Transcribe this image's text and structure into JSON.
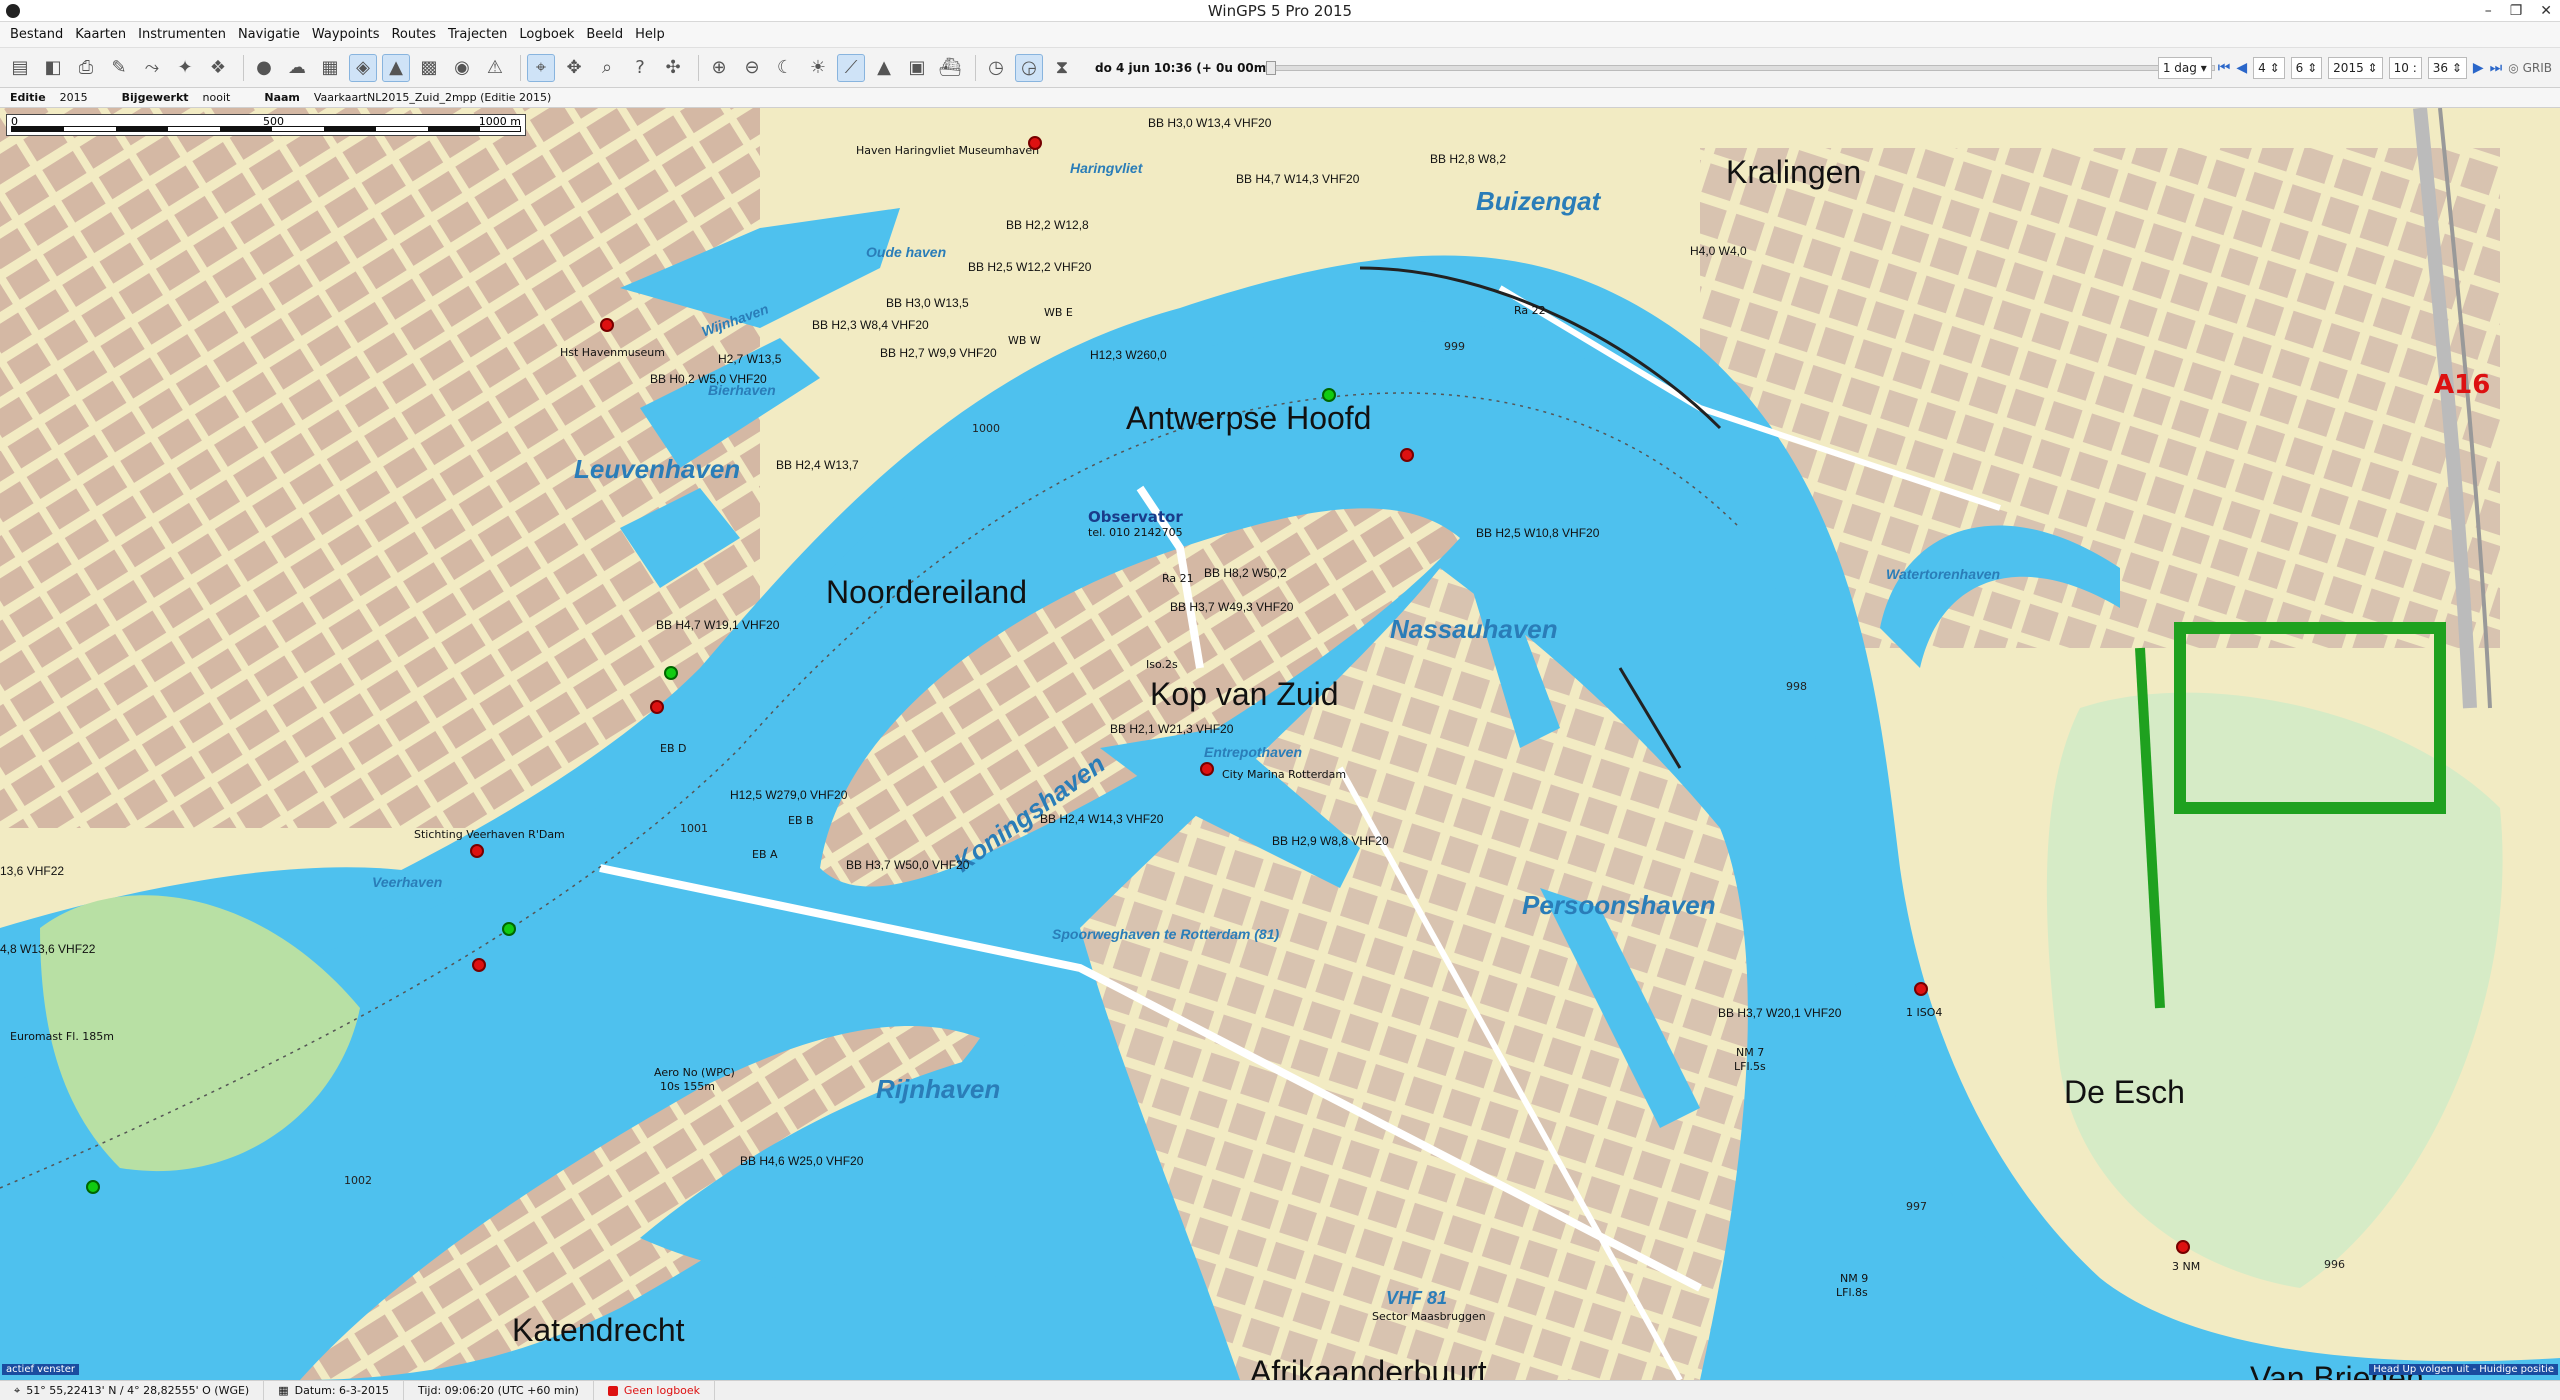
{
  "window": {
    "title": "WinGPS 5 Pro 2015"
  },
  "menu": [
    "Bestand",
    "Kaarten",
    "Instrumenten",
    "Navigatie",
    "Waypoints",
    "Routes",
    "Trajecten",
    "Logboek",
    "Beeld",
    "Help"
  ],
  "toolbar": {
    "datetime": "do 4 jun 10:36 (+ 0u 00m)",
    "interval": "1 dag",
    "day": "4",
    "month": "6",
    "year": "2015",
    "hour": "10",
    "minute": "36",
    "grib_label": "GRIB"
  },
  "infobar": {
    "edition_label": "Editie",
    "edition_value": "2015",
    "updated_label": "Bijgewerkt",
    "updated_value": "nooit",
    "name_label": "Naam",
    "name_value": "VaarkaartNL2015_Zuid_2mpp (Editie 2015)"
  },
  "map": {
    "scale": {
      "start": "0",
      "mid": "500",
      "end": "1000 m"
    },
    "places": [
      "Kralingen",
      "Antwerpse Hoofd",
      "Noordereiland",
      "Kop van Zuid",
      "De Esch",
      "Katendrecht",
      "Afrikaanderbuurt",
      "Van Brienen"
    ],
    "waters": {
      "big": [
        "Buizengat",
        "Leuvenhaven",
        "Nassauhaven",
        "Koningshaven",
        "Persoonshaven",
        "Rijnhaven",
        "Veerhaven"
      ],
      "small": [
        "Haringvliet",
        "Oude haven",
        "Wijnhaven",
        "Bierhaven",
        "Watertorenhaven",
        "Spoorweghaven te Rotterdam (81)",
        "Entrepothaven",
        "VHF 81",
        "Sector Maasbruggen"
      ]
    },
    "bridges": [
      "BB H3,0 W13,4 VHF20",
      "BB H4,7 W14,3 VHF20",
      "BB H2,8 W8,2",
      "BB H2,2 W12,8",
      "BB H2,5 W12,2 VHF20",
      "BB H3,0 W13,5",
      "BB H2,3 W8,4 VHF20",
      "BB H2,7 W9,9 VHF20",
      "H2,7 W13,5",
      "BB H0,2 W5,0 VHF20",
      "H12,3 W260,0",
      "H4,0 W4,0",
      "BB H2,4 W13,7",
      "BB H2,5 W10,8 VHF20",
      "BB H8,2 W50,2",
      "BB H3,7 W49,3 VHF20",
      "BB H4,7 W19,1 VHF20",
      "BB H2,1 W21,3 VHF20",
      "H12,5 W279,0 VHF20",
      "BB H2,4 W14,3 VHF20",
      "BB H2,9 W8,8 VHF20",
      "BB H3,7 W50,0 VHF20",
      "BB H3,7 W20,1 VHF20",
      "BB H4,6 W25,0 VHF20",
      "13,6 VHF22",
      "4,8 W13,6 VHF22"
    ],
    "pois": [
      "Haven Haringvliet Museumhaven",
      "Hst Havenmuseum",
      "WB E",
      "WB W",
      "Ra 22",
      "Observator",
      "tel. 010 2142705",
      "Ra 21",
      "Iso.2s",
      "City Marina Rotterdam",
      "EB D",
      "EB B",
      "EB A",
      "Stichting Veerhaven R'Dam",
      "Euromast Fl. 185m",
      "Aero No (WPC)",
      "10s 155m",
      "1 ISO4",
      "NM 7",
      "LFl.5s",
      "NM 9",
      "LFl.8s",
      "3 NM",
      "A16"
    ],
    "depths": [
      "999",
      "1000",
      "998",
      "1001",
      "1002",
      "997",
      "996"
    ],
    "corner_left": "actief venster",
    "corner_right": "Head Up volgen uit - Huidige positie"
  },
  "status": {
    "position": "51° 55,22413' N / 4° 28,82555' O (WGE)",
    "date": "Datum: 6-3-2015",
    "time": "Tijd: 09:06:20 (UTC +60 min)",
    "logbook": "Geen logboek"
  },
  "colors": {
    "water": "#4ec1ee",
    "land": "#f2ebc3",
    "buildings": "#d4b8a4",
    "parks": "#b8e0a4",
    "green_dark": "#1fa11f",
    "road": "#ffffff"
  }
}
